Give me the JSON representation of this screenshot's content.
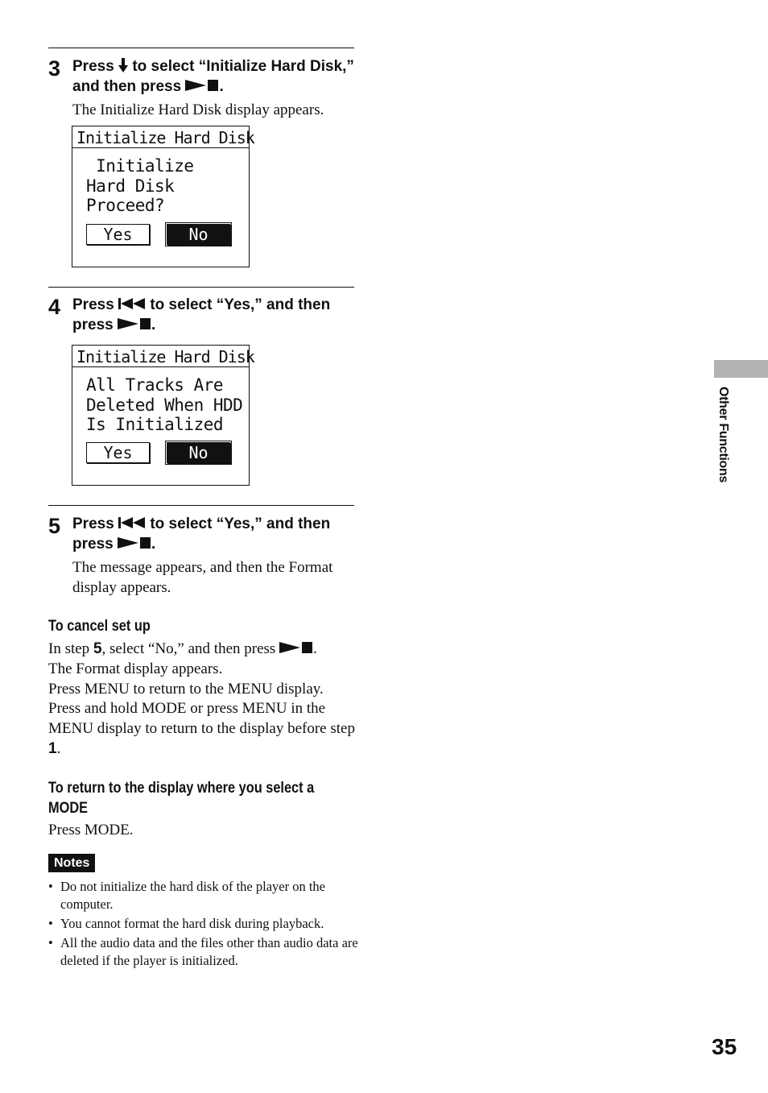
{
  "step3": {
    "number": "3",
    "instruction_a": "Press",
    "instruction_b": "to select “Initialize Hard Disk,” and then press",
    "instruction_end": ".",
    "icon_down": "down-arrow-icon",
    "icon_play": "play-stop-icon",
    "description": "The Initialize Hard Disk display appears.",
    "screen": {
      "title": "Initialize Hard Disk",
      "body": " Initialize\nHard Disk\nProceed?",
      "yes_label": "Yes",
      "no_label": "No",
      "selected": "No"
    }
  },
  "step4": {
    "number": "4",
    "instruction_a": "Press",
    "instruction_b": "to select “Yes,” and then press",
    "instruction_end": ".",
    "icon_prev": "previous-track-icon",
    "icon_play": "play-stop-icon",
    "screen": {
      "title": "Initialize Hard Disk",
      "body": "All Tracks Are\nDeleted When HDD\nIs Initialized",
      "yes_label": "Yes",
      "no_label": "No",
      "selected": "No"
    }
  },
  "step5": {
    "number": "5",
    "instruction_a": "Press",
    "instruction_b": "to select “Yes,” and then press",
    "instruction_end": ".",
    "icon_prev": "previous-track-icon",
    "icon_play": "play-stop-icon",
    "description": "The message appears, and then the Format display appears."
  },
  "cancel": {
    "heading": "To cancel set up",
    "line1_a": "In step ",
    "line1_step": "5",
    "line1_b": ", select “No,” and then press ",
    "line1_end": ".",
    "line2": "The Format display appears.",
    "line3": "Press MENU to return to the MENU display.",
    "line4_a": "Press and hold MODE or press MENU in the MENU display to return to the display before step ",
    "line4_step": "1",
    "line4_end": "."
  },
  "return_mode": {
    "heading": "To return to the display where you select a MODE",
    "text": "Press MODE."
  },
  "notes": {
    "badge": "Notes",
    "items": [
      "Do not initialize the hard disk of the player on the computer.",
      "You cannot format the hard disk during playback.",
      "All the audio data and the files other than audio data are deleted if the player is initialized."
    ]
  },
  "side_tab": {
    "label": "Other Functions",
    "color": "#b3b3b3"
  },
  "page_number": "35"
}
